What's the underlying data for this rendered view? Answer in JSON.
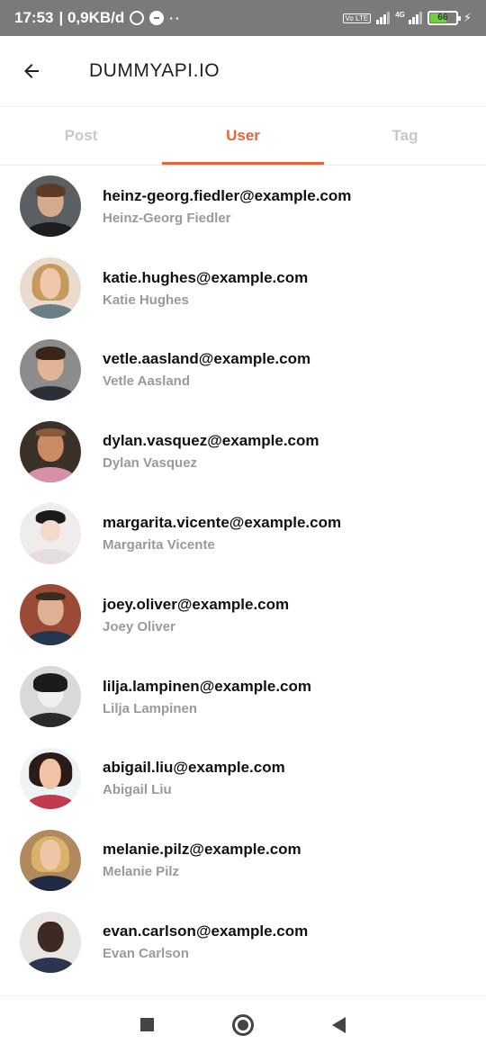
{
  "status_bar": {
    "time": "17:53",
    "network_speed": "| 0,9KB/d",
    "volte_label": "Vo LTE",
    "network_type": "4G",
    "battery_level": "66",
    "battery_color": "#6fd13a",
    "icons": [
      "alarm-icon",
      "messenger-icon",
      "more-dots-icon",
      "signal-icon",
      "charging-icon"
    ]
  },
  "app_bar": {
    "title": "DUMMYAPI.IO",
    "back_icon": "arrow-left-icon"
  },
  "tabs": [
    {
      "label": "Post",
      "active": false
    },
    {
      "label": "User",
      "active": true
    },
    {
      "label": "Tag",
      "active": false
    }
  ],
  "accent_color": "#e7643a",
  "users": [
    {
      "email": "heinz-georg.fiedler@example.com",
      "name": "Heinz-Georg Fiedler"
    },
    {
      "email": "katie.hughes@example.com",
      "name": "Katie Hughes"
    },
    {
      "email": "vetle.aasland@example.com",
      "name": "Vetle Aasland"
    },
    {
      "email": "dylan.vasquez@example.com",
      "name": "Dylan Vasquez"
    },
    {
      "email": "margarita.vicente@example.com",
      "name": "Margarita Vicente"
    },
    {
      "email": "joey.oliver@example.com",
      "name": "Joey Oliver"
    },
    {
      "email": "lilja.lampinen@example.com",
      "name": "Lilja Lampinen"
    },
    {
      "email": "abigail.liu@example.com",
      "name": "Abigail Liu"
    },
    {
      "email": "melanie.pilz@example.com",
      "name": "Melanie Pilz"
    },
    {
      "email": "evan.carlson@example.com",
      "name": "Evan Carlson"
    }
  ],
  "nav_bar": {
    "icons": [
      "recents-square-icon",
      "home-circle-icon",
      "back-triangle-icon"
    ]
  }
}
